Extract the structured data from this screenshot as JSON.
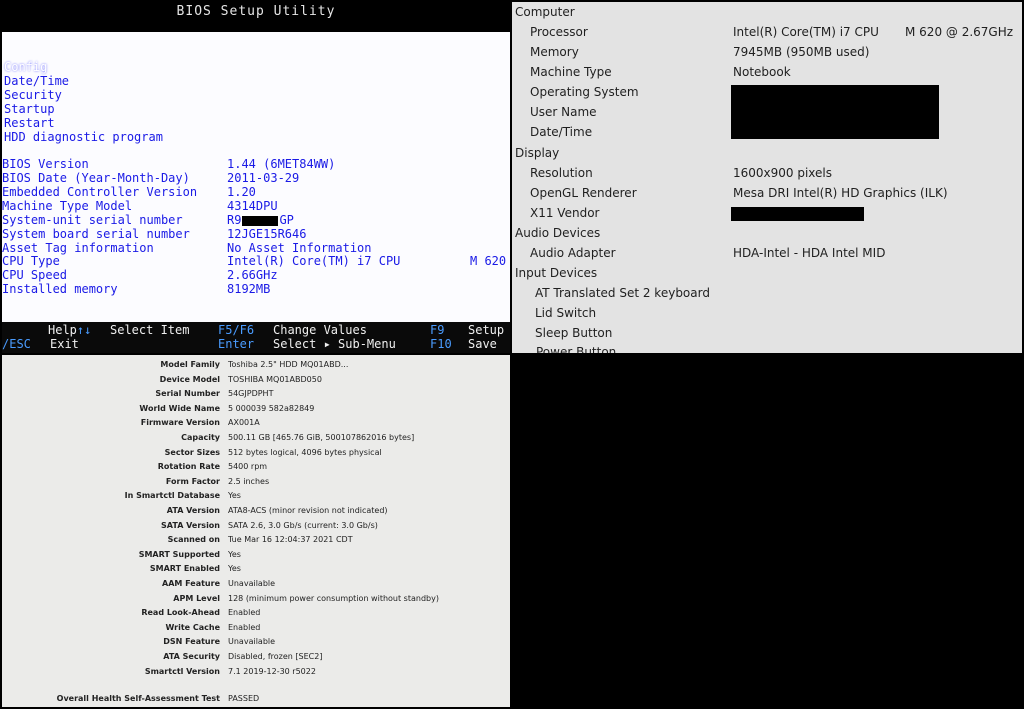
{
  "bios": {
    "title": "BIOS Setup Utility",
    "menu": [
      {
        "label": "Config",
        "selected": true
      },
      {
        "label": "Date/Time"
      },
      {
        "label": "Security"
      },
      {
        "label": "Startup"
      },
      {
        "label": "Restart"
      },
      {
        "label": "HDD diagnostic program"
      }
    ],
    "info": [
      {
        "label": "BIOS Version",
        "value": "1.44  (6MET84WW)"
      },
      {
        "label": "BIOS Date (Year-Month-Day)",
        "value": "2011-03-29"
      },
      {
        "label": "Embedded Controller Version",
        "value": "1.20"
      },
      {
        "label": "Machine Type Model",
        "value": "4314DPU"
      },
      {
        "label": "System-unit serial number",
        "value_prefix": "R9",
        "value_suffix": "GP"
      },
      {
        "label": "System board serial number",
        "value": "12JGE15R646"
      },
      {
        "label": "Asset Tag information",
        "value": "No Asset Information"
      },
      {
        "label": "CPU Type",
        "value": "Intel(R) Core(TM) i7 CPU",
        "value_extra": "M 620"
      },
      {
        "label": "CPU Speed",
        "value": "2.66GHz"
      },
      {
        "label": "Installed memory",
        "value": "8192MB"
      }
    ],
    "footer": {
      "help_key": "Help",
      "help_arrows": "↑↓",
      "select_item": "Select Item",
      "esc_key": "/ESC",
      "exit": "Exit",
      "f5f6_key": "F5/F6",
      "change_values": "Change Values",
      "enter_key": "Enter",
      "select_submenu": "Select ▸ Sub-Menu",
      "f9_key": "F9",
      "setup": "Setup",
      "f10_key": "F10",
      "save": "Save"
    }
  },
  "hardware": {
    "computer": "Computer",
    "processor_label": "Processor",
    "processor_value": "Intel(R) Core(TM) i7 CPU",
    "processor_model": "M 620  @ 2.67GHz",
    "memory_label": "Memory",
    "memory_value": "7945MB (950MB used)",
    "machine_type_label": "Machine Type",
    "machine_type_value": "Notebook",
    "os_label": "Operating System",
    "user_label": "User Name",
    "datetime_label": "Date/Time",
    "display": "Display",
    "resolution_label": "Resolution",
    "resolution_value": "1600x900 pixels",
    "opengl_label": "OpenGL Renderer",
    "opengl_value": "Mesa DRI Intel(R) HD Graphics (ILK)",
    "x11_label": "X11 Vendor",
    "audio_devices": "Audio Devices",
    "audio_adapter_label": "Audio Adapter",
    "audio_adapter_value": "HDA-Intel - HDA Intel MID",
    "input_devices": "Input Devices",
    "input_items": [
      "AT Translated Set 2 keyboard",
      "Lid Switch",
      "Sleep Button"
    ],
    "cut_item": "Power Button"
  },
  "smart": {
    "rows": [
      {
        "k": "Model Family",
        "v": "Toshiba 2.5\" HDD MQ01ABD..."
      },
      {
        "k": "Device Model",
        "v": "TOSHIBA MQ01ABD050"
      },
      {
        "k": "Serial Number",
        "v": "54GJPDPHT"
      },
      {
        "k": "World Wide Name",
        "v": "5 000039 582a82849"
      },
      {
        "k": "Firmware Version",
        "v": "AX001A"
      },
      {
        "k": "Capacity",
        "v": "500.11 GB [465.76 GiB, 500107862016 bytes]"
      },
      {
        "k": "Sector Sizes",
        "v": "512 bytes logical, 4096 bytes physical"
      },
      {
        "k": "Rotation Rate",
        "v": "5400 rpm"
      },
      {
        "k": "Form Factor",
        "v": "2.5 inches"
      },
      {
        "k": "In Smartctl Database",
        "v": "Yes"
      },
      {
        "k": "ATA Version",
        "v": "ATA8-ACS (minor revision not indicated)"
      },
      {
        "k": "SATA Version",
        "v": "SATA 2.6, 3.0 Gb/s (current: 3.0 Gb/s)"
      },
      {
        "k": "Scanned on",
        "v": "Tue Mar 16 12:04:37 2021 CDT"
      },
      {
        "k": "SMART Supported",
        "v": "Yes"
      },
      {
        "k": "SMART Enabled",
        "v": "Yes"
      },
      {
        "k": "AAM Feature",
        "v": "Unavailable"
      },
      {
        "k": "APM Level",
        "v": "128 (minimum power consumption without standby)"
      },
      {
        "k": "Read Look-Ahead",
        "v": "Enabled"
      },
      {
        "k": "Write Cache",
        "v": "Enabled"
      },
      {
        "k": "DSN Feature",
        "v": "Unavailable"
      },
      {
        "k": "ATA Security",
        "v": "Disabled, frozen [SEC2]"
      },
      {
        "k": "Smartctl Version",
        "v": "7.1 2019-12-30 r5022"
      }
    ],
    "health_label": "Overall Health Self-Assessment Test",
    "health_value": "PASSED"
  }
}
